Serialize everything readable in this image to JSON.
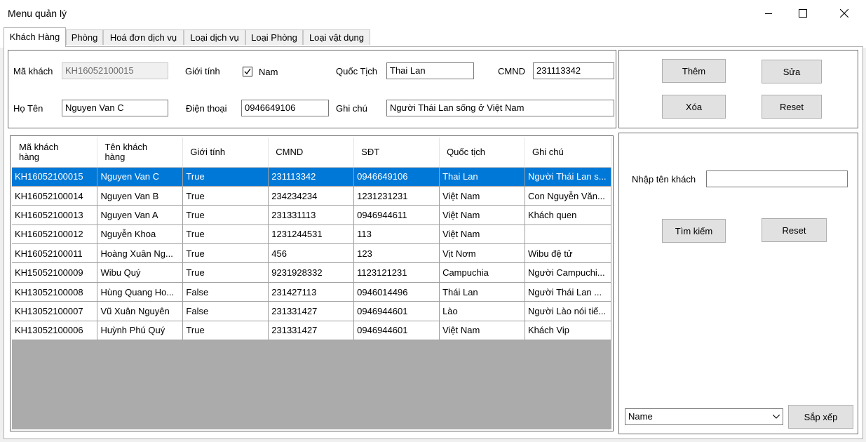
{
  "window": {
    "title": "Menu quản lý"
  },
  "tabs": [
    "Khách Hàng",
    "Phòng",
    "Hoá đơn dịch vụ",
    "Loại dịch vụ",
    "Loại Phòng",
    "Loại vật dụng"
  ],
  "form": {
    "ma_khach_label": "Mã khách",
    "ma_khach_value": "KH16052100015",
    "gioi_tinh_label": "Giới tính",
    "nam_label": "Nam",
    "nam_checked": true,
    "quoc_tich_label": "Quốc Tịch",
    "quoc_tich_value": "Thai Lan",
    "cmnd_label": "CMND",
    "cmnd_value": "231113342",
    "ho_ten_label": "Họ Tên",
    "ho_ten_value": "Nguyen Van C",
    "dien_thoai_label": "Điện thoại",
    "dien_thoai_value": "0946649106",
    "ghi_chu_label": "Ghi chú",
    "ghi_chu_value": "Người Thái Lan sống ở Việt Nam"
  },
  "actions": {
    "them": "Thêm",
    "sua": "Sửa",
    "xoa": "Xóa",
    "reset": "Reset"
  },
  "search": {
    "label": "Nhập tên khách",
    "value": "",
    "search_button": "Tìm kiếm",
    "reset_button": "Reset",
    "sort_selected": "Name",
    "sort_button": "Sắp xếp"
  },
  "table": {
    "headers": [
      "Mã khách\nhàng",
      "Tên khách\nhàng",
      "Giới tính",
      "CMND",
      "SĐT",
      "Quốc tịch",
      "Ghi chú"
    ],
    "selected_row": 0,
    "rows": [
      [
        "KH16052100015",
        "Nguyen Van C",
        "True",
        "231113342",
        "0946649106",
        "Thai Lan",
        "Người Thái Lan s..."
      ],
      [
        "KH16052100014",
        "Nguyen Van B",
        "True",
        "234234234",
        "1231231231",
        "Việt Nam",
        "Con Nguyễn Văn..."
      ],
      [
        "KH16052100013",
        "Nguyen Van A",
        "True",
        "231331113",
        "0946944611",
        "Việt Nam",
        "Khách quen"
      ],
      [
        "KH16052100012",
        "Nguyễn Khoa",
        "True",
        "1231244531",
        "113",
        "Việt Nam",
        ""
      ],
      [
        "KH16052100011",
        "Hoàng Xuân Ng...",
        "True",
        "456",
        "123",
        "Vịt Nơm",
        "Wibu đệ tử"
      ],
      [
        "KH15052100009",
        "Wibu Quý",
        "True",
        "9231928332",
        "1123121231",
        "Campuchia",
        "Người Campuchi..."
      ],
      [
        "KH13052100008",
        "Hùng Quang Ho...",
        "False",
        "231427113",
        "0946014496",
        "Thái Lan",
        "Người Thái Lan ..."
      ],
      [
        "KH13052100007",
        "Vũ Xuân Nguyên",
        "False",
        "231331427",
        "0946944601",
        "Lào",
        "Người Lào nói tiế..."
      ],
      [
        "KH13052100006",
        "Huỳnh Phú Quý",
        "True",
        "231331427",
        "0946944601",
        "Việt Nam",
        "Khách Vip"
      ]
    ]
  }
}
